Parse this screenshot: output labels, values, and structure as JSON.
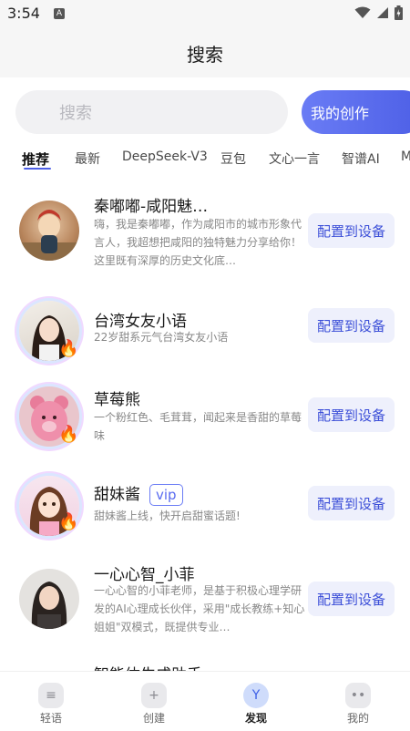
{
  "status_bar": {
    "time": "3:54",
    "badge": "A"
  },
  "header": {
    "title": "搜索"
  },
  "search": {
    "placeholder": "搜索",
    "create_label": "我的创作"
  },
  "tabs": [
    "推荐",
    "最新",
    "DeepSeek-V3",
    "豆包",
    "文心一言",
    "智谱AI",
    "M"
  ],
  "active_tab": 0,
  "items": [
    {
      "name": "秦嘟嘟-咸阳魅…",
      "desc": "嗨，我是秦嘟嘟，作为咸阳市的城市形象代言人，我超想把咸阳的独特魅力分享给你！这里既有深厚的历史文化底…",
      "button": "配置到设备",
      "badge": ""
    },
    {
      "name": "台湾女友小语",
      "desc": "22岁甜系元气台湾女友小语",
      "button": "配置到设备",
      "badge": ""
    },
    {
      "name": "草莓熊",
      "desc": "一个粉红色、毛茸茸，闻起来是香甜的草莓味",
      "button": "配置到设备",
      "badge": ""
    },
    {
      "name": "甜妹酱",
      "desc": "甜妹酱上线，快开启甜蜜话题!",
      "button": "配置到设备",
      "badge": "vip"
    },
    {
      "name": "一心心智_小菲",
      "desc": "一心心智的小菲老师，是基于积极心理学研发的AI心理成长伙伴，采用\"成长教练+知心姐姐\"双模式，既提供专业…",
      "button": "配置到设备",
      "badge": ""
    },
    {
      "name": "智能体生成助手",
      "desc": "",
      "button": "",
      "badge": ""
    }
  ],
  "bottom_nav": [
    {
      "label": "轻语",
      "icon": "chat-icon"
    },
    {
      "label": "创建",
      "icon": "plus-icon"
    },
    {
      "label": "发现",
      "icon": "discover-icon"
    },
    {
      "label": "我的",
      "icon": "profile-icon"
    }
  ],
  "active_nav": 2,
  "colors": {
    "accent": "#4d5fe6",
    "button_bg": "#eef0fc",
    "button_text": "#3c4fd8"
  }
}
